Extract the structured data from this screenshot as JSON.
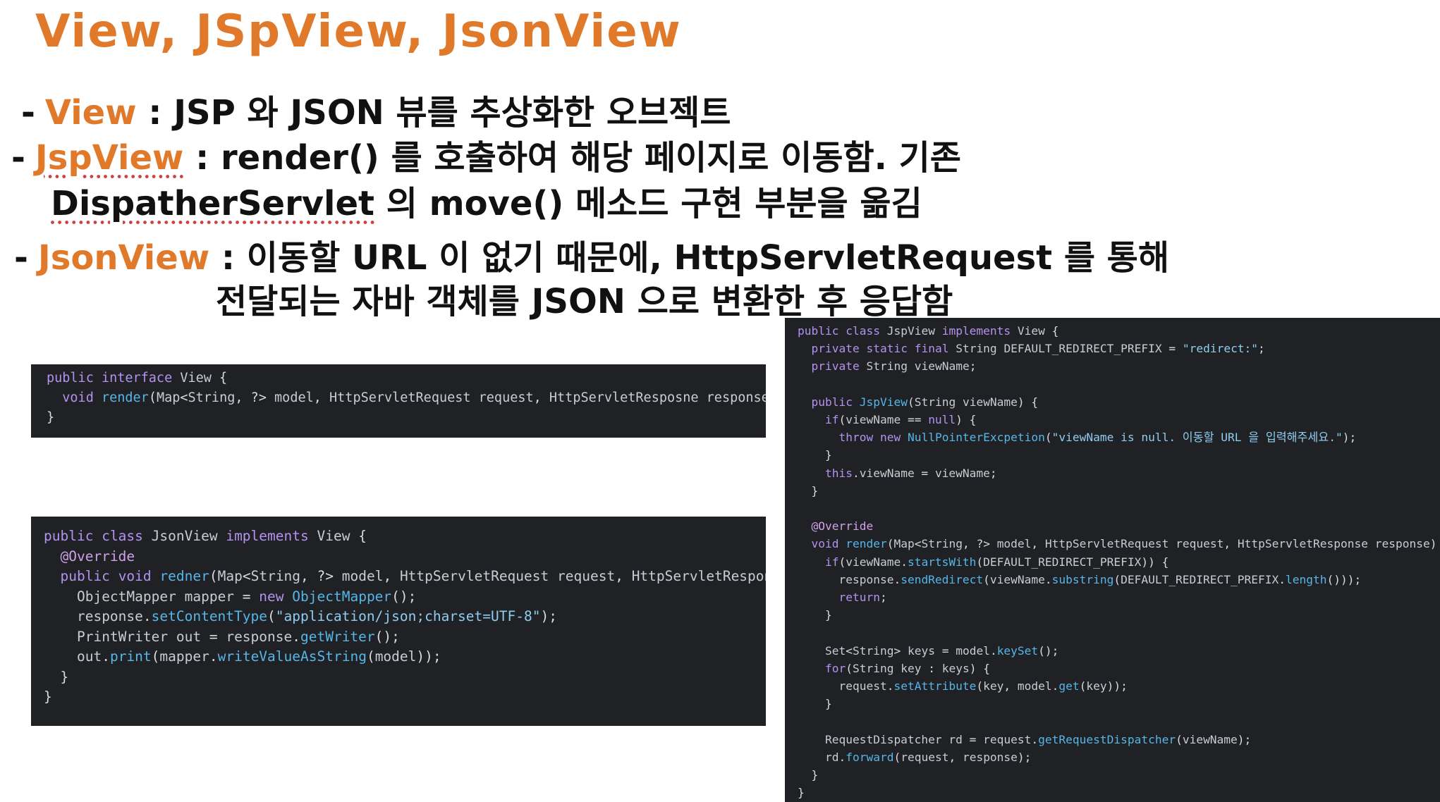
{
  "title": "View, JSpView, JsonView",
  "bullets": [
    {
      "dash": "-",
      "keyword": "View",
      "text": " : JSP 와 JSON 뷰를 추상화한 오브젝트"
    },
    {
      "dash": "-",
      "keyword": "JspView",
      "text": " : render() 를 호출하여 해당 페이지로 이동함. 기존"
    },
    {
      "dash": "-",
      "keyword": "JsonView",
      "text": " : 이동할 URL 이 없기 때문에, HttpServletRequest 를 통해"
    }
  ],
  "continuations": {
    "jspview_line2_underlined": "DispatherServlet",
    "jspview_line2_rest": " 의 move() 메소드 구현 부분을 옮김",
    "jsonview_line2": "전달되는 자바 객체를 JSON 으로 변환한 후 응답함"
  },
  "code_view": [
    "public interface View {",
    "  void render(Map<String, ?> model, HttpServletRequest request, HttpServletResposne response);",
    "}"
  ],
  "code_jsonview": [
    "public class JsonView implements View {",
    "  @Override",
    "  public void redner(Map<String, ?> model, HttpServletRequest request, HttpServletResponse response) {",
    "    ObjectMapper mapper = new ObjectMapper();",
    "    response.setContentType(\"application/json;charset=UTF-8\");",
    "    PrintWriter out = response.getWriter();",
    "    out.print(mapper.writeValueAsString(model));",
    "  }",
    "}"
  ],
  "code_jspview": [
    "public class JspView implements View {",
    "  private static final String DEFAULT_REDIRECT_PREFIX = \"redirect:\";",
    "  private String viewName;",
    "",
    "  public JspView(String viewName) {",
    "    if(viewName == null) {",
    "      throw new NullPointerExcpetion(\"viewName is null. 이동할 URL 을 입력해주세요.\");",
    "    }",
    "    this.viewName = viewName;",
    "  }",
    "",
    "  @Override",
    "  void render(Map<String, ?> model, HttpServletRequest request, HttpServletResponse response) {",
    "    if(viewName.startsWith(DEFAULT_REDIRECT_PREFIX)) {",
    "      response.sendRedirect(viewName.substring(DEFAULT_REDIRECT_PREFIX.length()));",
    "      return;",
    "    }",
    "",
    "    Set<String> keys = model.keySet();",
    "    for(String key : keys) {",
    "      request.setAttribute(key, model.get(key));",
    "    }",
    "",
    "    RequestDispatcher rd = request.getRequestDispatcher(viewName);",
    "    rd.forward(request, response);",
    "  }",
    "}"
  ],
  "colors": {
    "accent": "#e07a2a",
    "code_bg": "#1f2125",
    "keyword": "#b392f0",
    "method": "#56b6e8",
    "string": "#8fcdf0"
  }
}
